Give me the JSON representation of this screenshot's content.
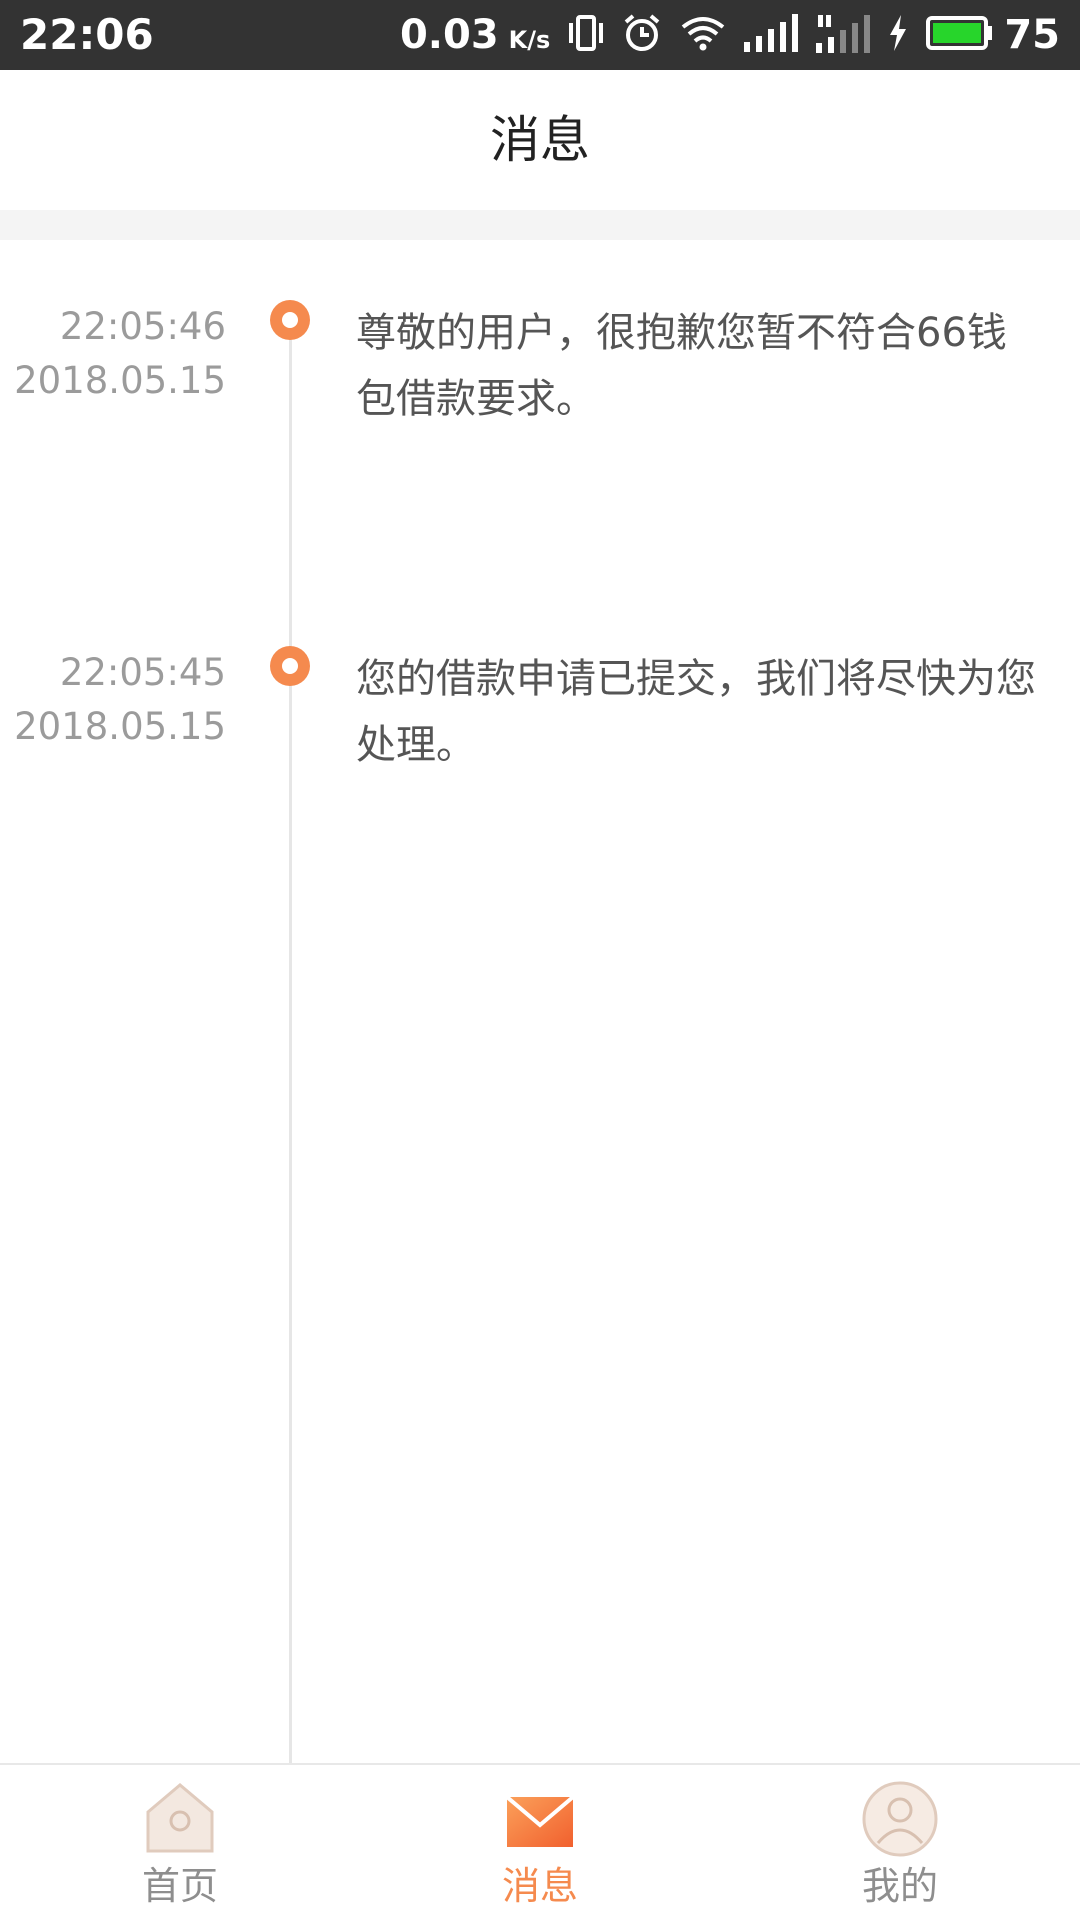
{
  "status_bar": {
    "time": "22:06",
    "net_speed": "0.03",
    "net_speed_unit": "K/s",
    "network_type": "4G",
    "battery_level": "75",
    "icons": [
      "vibrate-icon",
      "alarm-icon",
      "wifi-icon",
      "signal-icon",
      "signal-4g-icon",
      "charging-icon",
      "battery-icon"
    ]
  },
  "header": {
    "title": "消息"
  },
  "messages": [
    {
      "time": "22:05:46",
      "date": "2018.05.15",
      "text": "尊敬的用户，很抱歉您暂不符合66钱包借款要求。"
    },
    {
      "time": "22:05:45",
      "date": "2018.05.15",
      "text": "您的借款申请已提交，我们将尽快为您处理。"
    }
  ],
  "bottom_nav": {
    "items": [
      {
        "label": "首页",
        "icon": "home-icon",
        "active": false
      },
      {
        "label": "消息",
        "icon": "mail-icon",
        "active": true
      },
      {
        "label": "我的",
        "icon": "profile-icon",
        "active": false
      }
    ]
  },
  "colors": {
    "accent": "#f58a4e",
    "status_bar": "#333333",
    "timestamp_text": "#9b9b9b",
    "message_text": "#555555",
    "inactive_nav": "#8e8e8e",
    "battery_fill": "#27d52b"
  }
}
